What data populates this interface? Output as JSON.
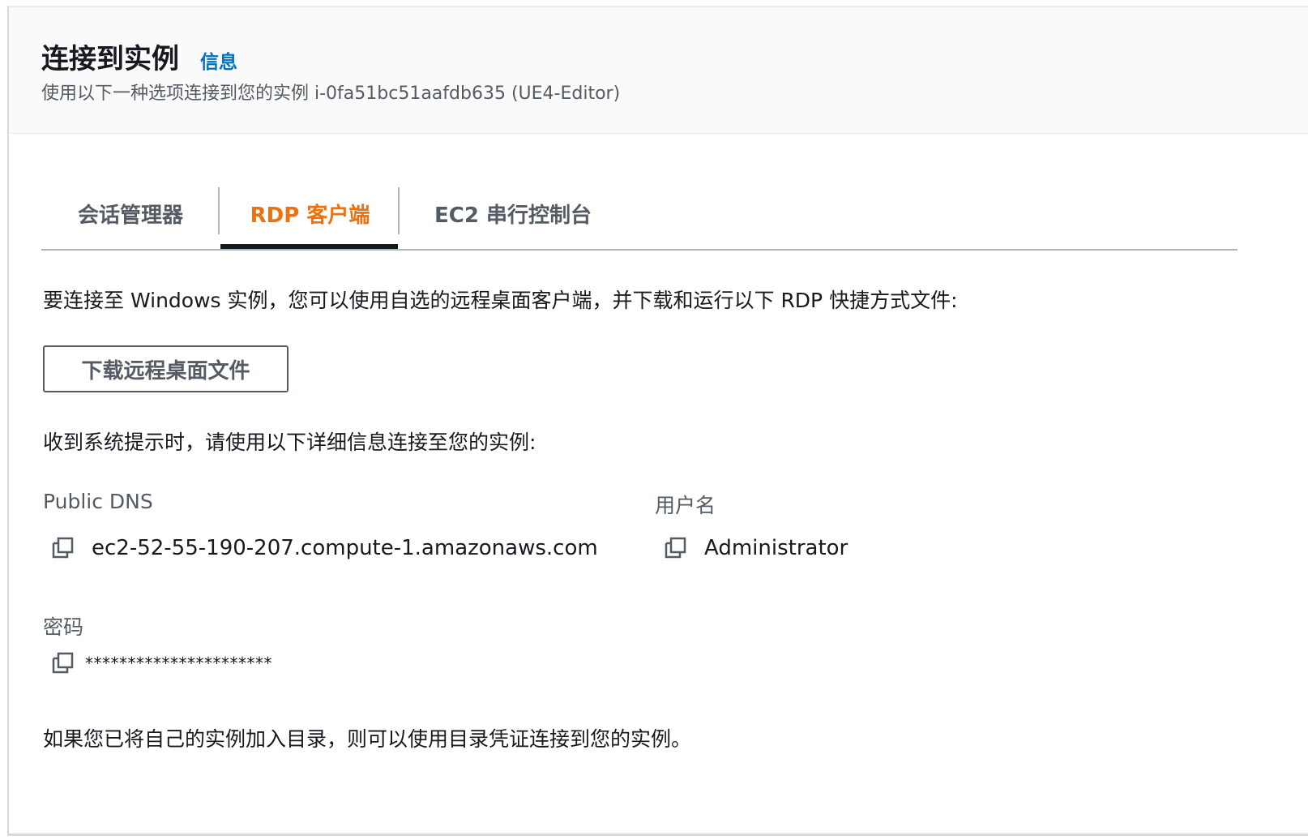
{
  "header": {
    "title": "连接到实例",
    "info_link": "信息",
    "subtitle": "使用以下一种选项连接到您的实例 i-0fa51bc51aafdb635 (UE4-Editor)"
  },
  "tabs": [
    {
      "label": "会话管理器",
      "active": false
    },
    {
      "label": "RDP 客户端",
      "active": true
    },
    {
      "label": "EC2 串行控制台",
      "active": false
    }
  ],
  "rdp": {
    "intro": "要连接至 Windows 实例，您可以使用自选的远程桌面客户端，并下载和运行以下 RDP 快捷方式文件:",
    "download_button": "下载远程桌面文件",
    "prompt": "收到系统提示时，请使用以下详细信息连接至您的实例:",
    "public_dns": {
      "label": "Public DNS",
      "value": "ec2-52-55-190-207.compute-1.amazonaws.com",
      "icon": "copy-icon"
    },
    "username": {
      "label": "用户名",
      "value": "Administrator",
      "icon": "copy-icon"
    },
    "password": {
      "label": "密码",
      "value": "**********************",
      "icon": "copy-icon"
    },
    "footer": "如果您已将自己的实例加入目录，则可以使用目录凭证连接到您的实例。"
  },
  "colors": {
    "accent": "#ec7211",
    "link": "#0073bb",
    "text": "#16191f",
    "muted": "#545b64"
  }
}
